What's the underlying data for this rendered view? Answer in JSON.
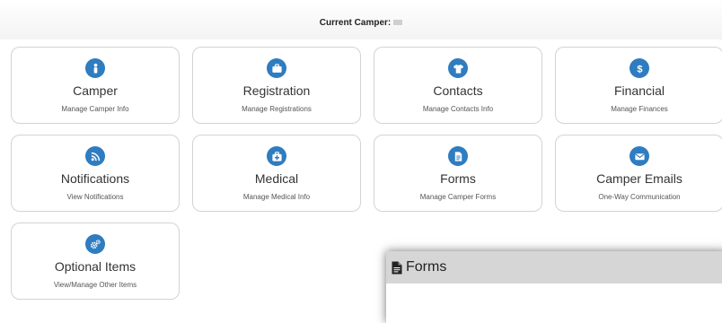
{
  "header": {
    "current_camper_label": "Current Camper:"
  },
  "tiles": [
    {
      "title": "Camper",
      "subtitle": "Manage Camper Info",
      "icon": "person-icon"
    },
    {
      "title": "Registration",
      "subtitle": "Manage Registrations",
      "icon": "briefcase-icon"
    },
    {
      "title": "Contacts",
      "subtitle": "Manage Contacts Info",
      "icon": "shirt-icon"
    },
    {
      "title": "Financial",
      "subtitle": "Manage Finances",
      "icon": "dollar-icon"
    },
    {
      "title": "Notifications",
      "subtitle": "View Notifications",
      "icon": "rss-icon"
    },
    {
      "title": "Medical",
      "subtitle": "Manage Medical Info",
      "icon": "medkit-icon"
    },
    {
      "title": "Forms",
      "subtitle": "Manage Camper Forms",
      "icon": "document-icon"
    },
    {
      "title": "Camper Emails",
      "subtitle": "One-Way Communication",
      "icon": "envelope-icon"
    },
    {
      "title": "Optional Items",
      "subtitle": "View/Manage Other Items",
      "icon": "gears-icon"
    }
  ],
  "modal": {
    "title": "Forms",
    "icon": "file-icon"
  },
  "colors": {
    "icon_blue": "#2f7cc0",
    "modal_header": "#d6d6d6",
    "tile_border": "#d3d3d3"
  }
}
